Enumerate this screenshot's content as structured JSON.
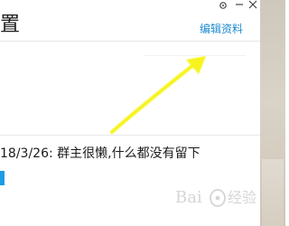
{
  "panel": {
    "title_fragment": "置",
    "edit_link": "编辑资料",
    "announcement": {
      "date": "18/3/26:",
      "text": "群主很懒,什么都没有留下"
    }
  },
  "window_controls": {
    "menu_icon": "settings-icon",
    "minimize_icon": "minimize-icon",
    "close_icon": "close-icon"
  },
  "annotation": {
    "color": "#f7f31a"
  },
  "watermark": {
    "text": "Bai 经验"
  }
}
